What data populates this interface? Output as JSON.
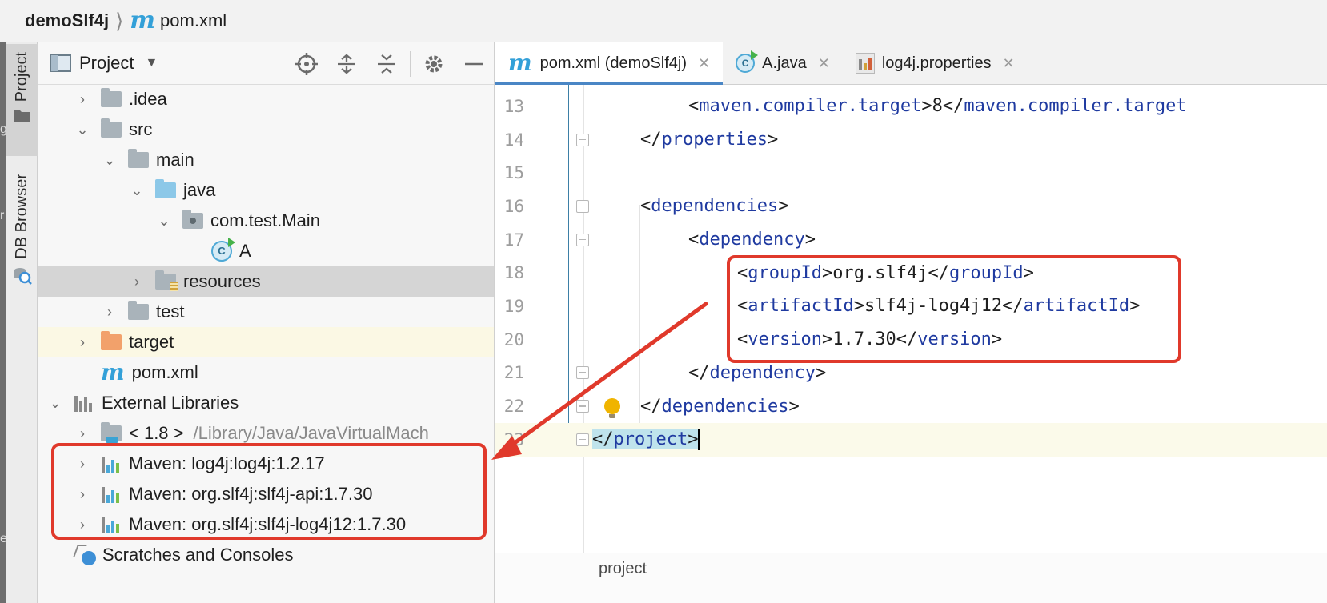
{
  "breadcrumb": {
    "project": "demoSlf4j",
    "separator": "⟩",
    "file_icon": "m",
    "file": "pom.xml"
  },
  "toolstrip": {
    "project_tab": "Project",
    "db_tab": "DB Browser",
    "edge_letters": [
      "g",
      "r",
      "e"
    ]
  },
  "project_panel": {
    "view_title": "Project",
    "toolbar_icons": [
      "locate-icon",
      "expand-all-icon",
      "collapse-all-icon",
      "gear-icon",
      "minimize-icon"
    ],
    "tree": [
      {
        "label": ".idea",
        "chevron": "›",
        "icon": "folder"
      },
      {
        "label": "src",
        "chevron": "⌄",
        "icon": "folder"
      },
      {
        "label": "main",
        "chevron": "⌄",
        "icon": "folder"
      },
      {
        "label": "java",
        "chevron": "⌄",
        "icon": "source-folder"
      },
      {
        "label": "com.test.Main",
        "chevron": "⌄",
        "icon": "package"
      },
      {
        "label": "A",
        "icon": "class"
      },
      {
        "label": "resources",
        "chevron": "›",
        "icon": "resources-folder"
      },
      {
        "label": "test",
        "chevron": "›",
        "icon": "folder"
      },
      {
        "label": "target",
        "chevron": "›",
        "icon": "excluded-folder"
      },
      {
        "label": "pom.xml",
        "icon": "maven-file"
      },
      {
        "label": "External Libraries",
        "chevron": "⌄",
        "icon": "library"
      },
      {
        "label": "< 1.8 >",
        "chevron": "›",
        "icon": "jdk",
        "path": "/Library/Java/JavaVirtualMach"
      },
      {
        "label": "Maven: log4j:log4j:1.2.17",
        "chevron": "›",
        "icon": "maven-library"
      },
      {
        "label": "Maven: org.slf4j:slf4j-api:1.7.30",
        "chevron": "›",
        "icon": "maven-library"
      },
      {
        "label": "Maven: org.slf4j:slf4j-log4j12:1.7.30",
        "chevron": "›",
        "icon": "maven-library"
      },
      {
        "label": "Scratches and Consoles",
        "icon": "scratches"
      }
    ]
  },
  "editor_tabs": [
    {
      "label": "pom.xml (demoSlf4j)",
      "icon": "m",
      "close": "✕"
    },
    {
      "label": "A.java",
      "icon": "C",
      "close": "✕"
    },
    {
      "label": "log4j.properties",
      "icon": "properties-file",
      "close": "✕"
    }
  ],
  "code_lines": [
    {
      "n": "13",
      "open": "maven.compiler.target",
      "text": "8",
      "close": "maven.compiler.target"
    },
    {
      "n": "14",
      "close": "properties"
    },
    {
      "n": "15"
    },
    {
      "n": "16",
      "open": "dependencies"
    },
    {
      "n": "17",
      "open": "dependency"
    },
    {
      "n": "18",
      "open": "groupId",
      "text": "org.slf4j",
      "close": "groupId"
    },
    {
      "n": "19",
      "open": "artifactId",
      "text": "slf4j-log4j12",
      "close": "artifactId"
    },
    {
      "n": "20",
      "open": "version",
      "text": "1.7.30",
      "close": "version"
    },
    {
      "n": "21",
      "close": "dependency"
    },
    {
      "n": "22",
      "close": "dependencies"
    },
    {
      "n": "23",
      "close": "project"
    }
  ],
  "editor_breadcrumb": "project",
  "colors": {
    "annotation_red": "#e0392b",
    "xml_tag": "#1f3aa0",
    "maven_icon": "#33a0d8",
    "tab_underline": "#4a86c5"
  }
}
